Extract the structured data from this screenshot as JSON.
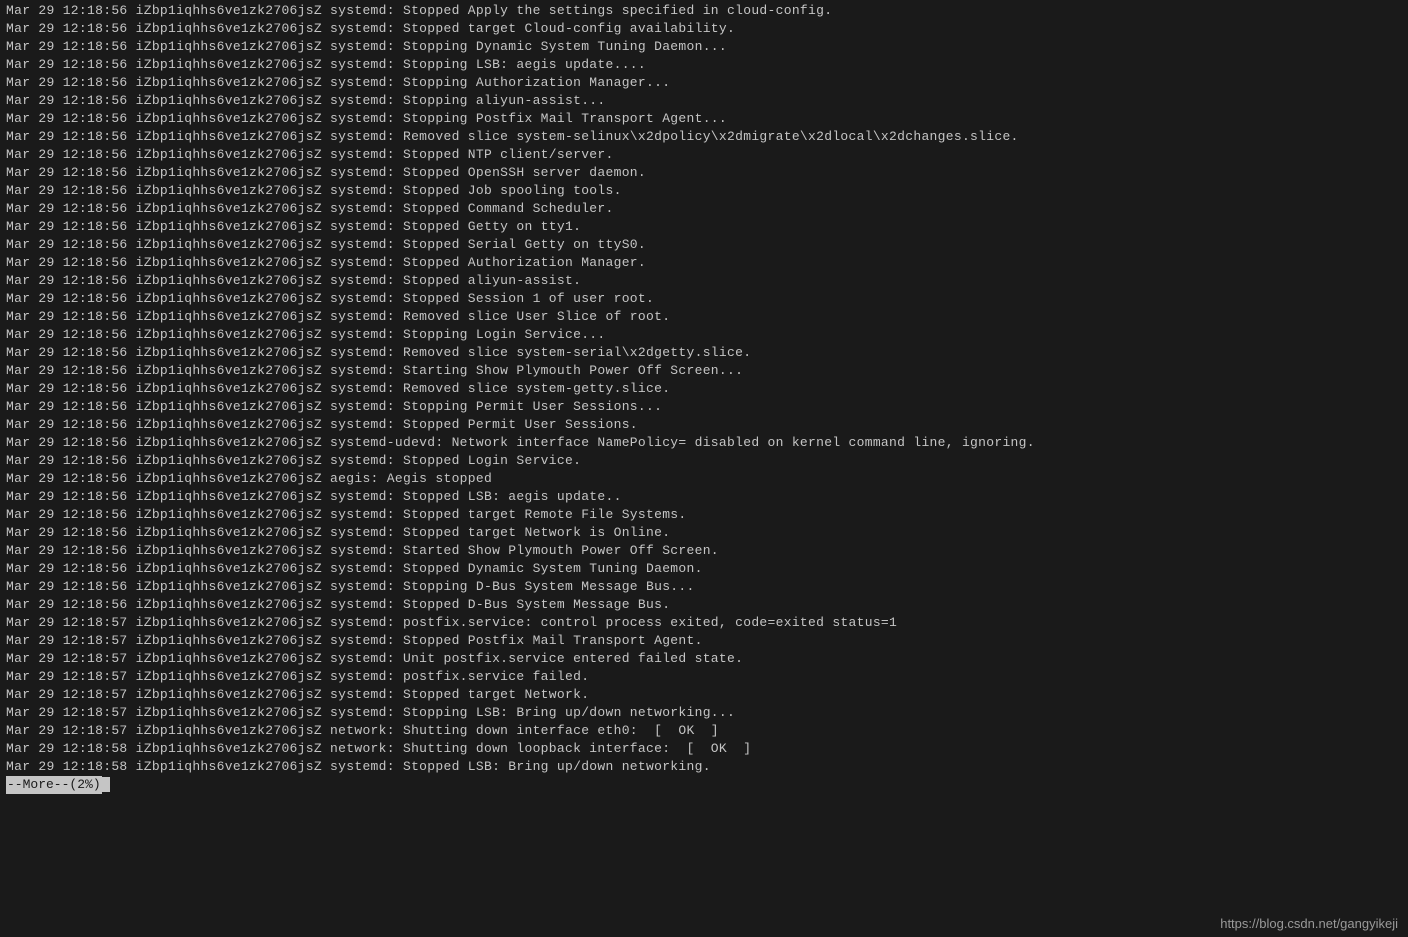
{
  "log_prefix": {
    "date": "Mar 29",
    "host": "iZbp1iqhhs6ve1zk2706jsZ"
  },
  "lines": [
    {
      "time": "12:18:56",
      "service": "systemd",
      "msg": "Stopped Apply the settings specified in cloud-config."
    },
    {
      "time": "12:18:56",
      "service": "systemd",
      "msg": "Stopped target Cloud-config availability."
    },
    {
      "time": "12:18:56",
      "service": "systemd",
      "msg": "Stopping Dynamic System Tuning Daemon..."
    },
    {
      "time": "12:18:56",
      "service": "systemd",
      "msg": "Stopping LSB: aegis update...."
    },
    {
      "time": "12:18:56",
      "service": "systemd",
      "msg": "Stopping Authorization Manager..."
    },
    {
      "time": "12:18:56",
      "service": "systemd",
      "msg": "Stopping aliyun-assist..."
    },
    {
      "time": "12:18:56",
      "service": "systemd",
      "msg": "Stopping Postfix Mail Transport Agent..."
    },
    {
      "time": "12:18:56",
      "service": "systemd",
      "msg": "Removed slice system-selinux\\x2dpolicy\\x2dmigrate\\x2dlocal\\x2dchanges.slice."
    },
    {
      "time": "12:18:56",
      "service": "systemd",
      "msg": "Stopped NTP client/server."
    },
    {
      "time": "12:18:56",
      "service": "systemd",
      "msg": "Stopped OpenSSH server daemon."
    },
    {
      "time": "12:18:56",
      "service": "systemd",
      "msg": "Stopped Job spooling tools."
    },
    {
      "time": "12:18:56",
      "service": "systemd",
      "msg": "Stopped Command Scheduler."
    },
    {
      "time": "12:18:56",
      "service": "systemd",
      "msg": "Stopped Getty on tty1."
    },
    {
      "time": "12:18:56",
      "service": "systemd",
      "msg": "Stopped Serial Getty on ttyS0."
    },
    {
      "time": "12:18:56",
      "service": "systemd",
      "msg": "Stopped Authorization Manager."
    },
    {
      "time": "12:18:56",
      "service": "systemd",
      "msg": "Stopped aliyun-assist."
    },
    {
      "time": "12:18:56",
      "service": "systemd",
      "msg": "Stopped Session 1 of user root."
    },
    {
      "time": "12:18:56",
      "service": "systemd",
      "msg": "Removed slice User Slice of root."
    },
    {
      "time": "12:18:56",
      "service": "systemd",
      "msg": "Stopping Login Service..."
    },
    {
      "time": "12:18:56",
      "service": "systemd",
      "msg": "Removed slice system-serial\\x2dgetty.slice."
    },
    {
      "time": "12:18:56",
      "service": "systemd",
      "msg": "Starting Show Plymouth Power Off Screen..."
    },
    {
      "time": "12:18:56",
      "service": "systemd",
      "msg": "Removed slice system-getty.slice."
    },
    {
      "time": "12:18:56",
      "service": "systemd",
      "msg": "Stopping Permit User Sessions..."
    },
    {
      "time": "12:18:56",
      "service": "systemd",
      "msg": "Stopped Permit User Sessions."
    },
    {
      "time": "12:18:56",
      "service": "systemd-udevd",
      "msg": "Network interface NamePolicy= disabled on kernel command line, ignoring."
    },
    {
      "time": "12:18:56",
      "service": "systemd",
      "msg": "Stopped Login Service."
    },
    {
      "time": "12:18:56",
      "service": "aegis",
      "msg": "Aegis stopped"
    },
    {
      "time": "12:18:56",
      "service": "systemd",
      "msg": "Stopped LSB: aegis update.."
    },
    {
      "time": "12:18:56",
      "service": "systemd",
      "msg": "Stopped target Remote File Systems."
    },
    {
      "time": "12:18:56",
      "service": "systemd",
      "msg": "Stopped target Network is Online."
    },
    {
      "time": "12:18:56",
      "service": "systemd",
      "msg": "Started Show Plymouth Power Off Screen."
    },
    {
      "time": "12:18:56",
      "service": "systemd",
      "msg": "Stopped Dynamic System Tuning Daemon."
    },
    {
      "time": "12:18:56",
      "service": "systemd",
      "msg": "Stopping D-Bus System Message Bus..."
    },
    {
      "time": "12:18:56",
      "service": "systemd",
      "msg": "Stopped D-Bus System Message Bus."
    },
    {
      "time": "12:18:57",
      "service": "systemd",
      "msg": "postfix.service: control process exited, code=exited status=1"
    },
    {
      "time": "12:18:57",
      "service": "systemd",
      "msg": "Stopped Postfix Mail Transport Agent."
    },
    {
      "time": "12:18:57",
      "service": "systemd",
      "msg": "Unit postfix.service entered failed state."
    },
    {
      "time": "12:18:57",
      "service": "systemd",
      "msg": "postfix.service failed."
    },
    {
      "time": "12:18:57",
      "service": "systemd",
      "msg": "Stopped target Network."
    },
    {
      "time": "12:18:57",
      "service": "systemd",
      "msg": "Stopping LSB: Bring up/down networking..."
    },
    {
      "time": "12:18:57",
      "service": "network",
      "msg": "Shutting down interface eth0:  [  OK  ]"
    },
    {
      "time": "12:18:58",
      "service": "network",
      "msg": "Shutting down loopback interface:  [  OK  ]"
    },
    {
      "time": "12:18:58",
      "service": "systemd",
      "msg": "Stopped LSB: Bring up/down networking."
    }
  ],
  "more_prompt": "--More--(2%)",
  "watermark": "https://blog.csdn.net/gangyikeji"
}
